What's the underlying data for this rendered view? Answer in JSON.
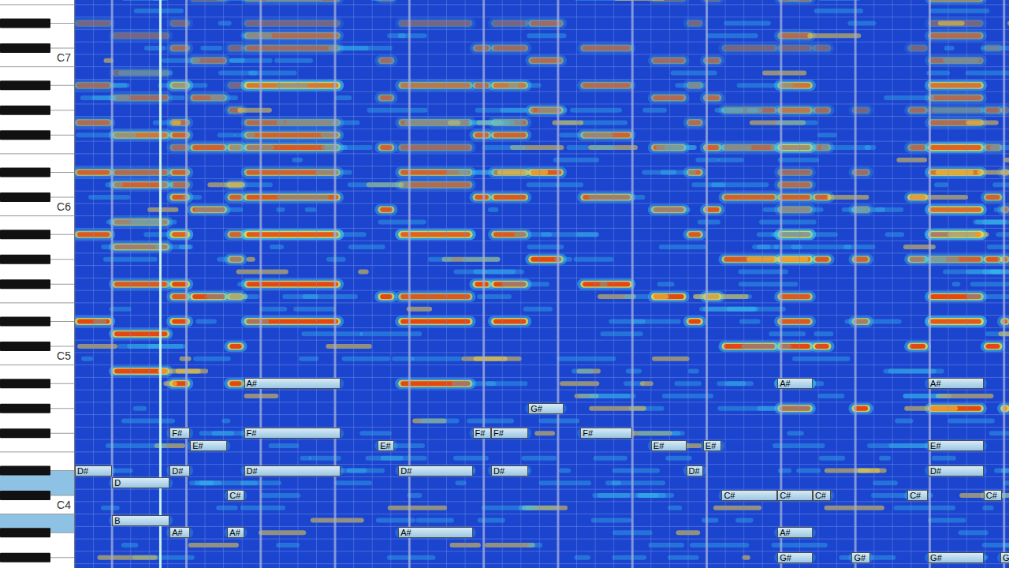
{
  "keyboard": {
    "labels": [
      {
        "text": "C7",
        "midi": 96
      },
      {
        "text": "C6",
        "midi": 84
      },
      {
        "text": "C5",
        "midi": 72
      },
      {
        "text": "C4",
        "midi": 60
      }
    ],
    "highlighted": [
      62,
      59
    ]
  },
  "playhead": {
    "beat": 4.6
  },
  "notes": [
    {
      "label": "D#",
      "midi": 63,
      "start": 0,
      "end": 2.0
    },
    {
      "label": "D",
      "midi": 62,
      "start": 2.0,
      "end": 5.1
    },
    {
      "label": "B",
      "midi": 59,
      "start": 2.0,
      "end": 5.1
    },
    {
      "label": "F#",
      "midi": 66,
      "start": 5.1,
      "end": 6.2
    },
    {
      "label": "D#",
      "midi": 63,
      "start": 5.1,
      "end": 6.2
    },
    {
      "label": "A#",
      "midi": 58,
      "start": 5.1,
      "end": 6.2
    },
    {
      "label": "E#",
      "midi": 65,
      "start": 6.2,
      "end": 8.2
    },
    {
      "label": "C#",
      "midi": 61,
      "start": 8.2,
      "end": 9.1
    },
    {
      "label": "A#",
      "midi": 58,
      "start": 8.2,
      "end": 9.1
    },
    {
      "label": "A#",
      "midi": 70,
      "start": 9.1,
      "end": 14.3
    },
    {
      "label": "F#",
      "midi": 66,
      "start": 9.1,
      "end": 14.3
    },
    {
      "label": "D#",
      "midi": 63,
      "start": 9.1,
      "end": 14.3
    },
    {
      "label": "E#",
      "midi": 65,
      "start": 16.3,
      "end": 17.2
    },
    {
      "label": "D#",
      "midi": 63,
      "start": 17.4,
      "end": 21.4
    },
    {
      "label": "A#",
      "midi": 58,
      "start": 17.4,
      "end": 21.4
    },
    {
      "label": "F#",
      "midi": 66,
      "start": 21.4,
      "end": 22.4
    },
    {
      "label": "F#",
      "midi": 66,
      "start": 22.4,
      "end": 24.4
    },
    {
      "label": "D#",
      "midi": 63,
      "start": 22.4,
      "end": 24.4
    },
    {
      "label": "G#",
      "midi": 68,
      "start": 24.4,
      "end": 26.3
    },
    {
      "label": "F#",
      "midi": 66,
      "start": 27.2,
      "end": 30.0
    },
    {
      "label": "E#",
      "midi": 65,
      "start": 31.0,
      "end": 32.9
    },
    {
      "label": "D#",
      "midi": 63,
      "start": 32.9,
      "end": 33.8
    },
    {
      "label": "E#",
      "midi": 65,
      "start": 33.8,
      "end": 34.8
    },
    {
      "label": "C#",
      "midi": 61,
      "start": 34.8,
      "end": 37.8
    },
    {
      "label": "C#",
      "midi": 61,
      "start": 37.8,
      "end": 39.7
    },
    {
      "label": "C#",
      "midi": 61,
      "start": 39.7,
      "end": 40.7
    },
    {
      "label": "A#",
      "midi": 70,
      "start": 37.8,
      "end": 39.7
    },
    {
      "label": "A#",
      "midi": 58,
      "start": 37.8,
      "end": 39.7
    },
    {
      "label": "G#",
      "midi": 56,
      "start": 37.8,
      "end": 39.7
    },
    {
      "label": "G#",
      "midi": 56,
      "start": 41.8,
      "end": 42.8
    },
    {
      "label": "C#",
      "midi": 61,
      "start": 44.8,
      "end": 45.9
    },
    {
      "label": "A#",
      "midi": 70,
      "start": 45.9,
      "end": 48.9
    },
    {
      "label": "E#",
      "midi": 65,
      "start": 45.9,
      "end": 48.9
    },
    {
      "label": "D#",
      "midi": 63,
      "start": 45.9,
      "end": 48.9
    },
    {
      "label": "G#",
      "midi": 56,
      "start": 45.9,
      "end": 48.9
    },
    {
      "label": "C#",
      "midi": 61,
      "start": 48.9,
      "end": 49.9
    },
    {
      "label": "G",
      "midi": 56,
      "start": 49.8,
      "end": 50.3
    }
  ]
}
